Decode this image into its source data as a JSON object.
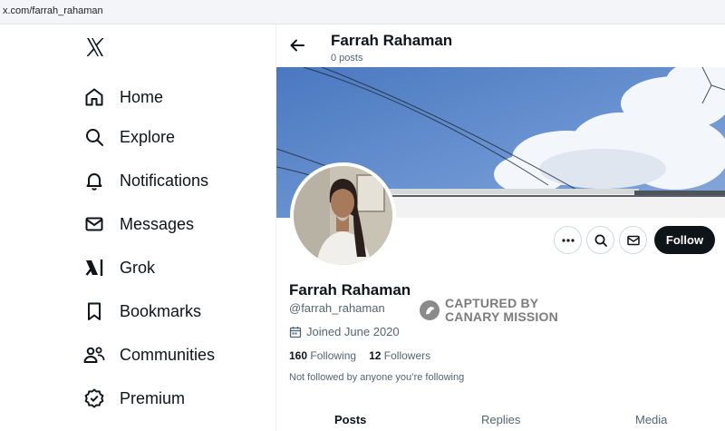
{
  "browser": {
    "url": "x.com/farrah_rahaman"
  },
  "sidebar": {
    "logo_icon": "x-logo-icon",
    "items": [
      {
        "label": "Home",
        "icon": "home-icon"
      },
      {
        "label": "Explore",
        "icon": "search-icon"
      },
      {
        "label": "Notifications",
        "icon": "bell-icon"
      },
      {
        "label": "Messages",
        "icon": "envelope-icon"
      },
      {
        "label": "Grok",
        "icon": "grok-icon"
      },
      {
        "label": "Bookmarks",
        "icon": "bookmark-icon"
      },
      {
        "label": "Communities",
        "icon": "people-icon"
      },
      {
        "label": "Premium",
        "icon": "verified-badge-icon"
      }
    ]
  },
  "header": {
    "name": "Farrah Rahaman",
    "posts": "0 posts"
  },
  "profile": {
    "name": "Farrah Rahaman",
    "handle": "@farrah_rahaman",
    "joined": "Joined June 2020",
    "following_count": "160",
    "following_label": "Following",
    "followers_count": "12",
    "followers_label": "Followers",
    "not_followed": "Not followed by anyone you’re following",
    "follow_label": "Follow"
  },
  "watermark": {
    "line1": "CAPTURED BY",
    "line2": "CANARY MISSION"
  },
  "tabs": [
    {
      "label": "Posts",
      "active": true
    },
    {
      "label": "Replies",
      "active": false
    },
    {
      "label": "Media",
      "active": false
    }
  ],
  "colors": {
    "follow_bg": "#0f1419",
    "sky": "#4f7fc6",
    "muted": "#536471"
  }
}
